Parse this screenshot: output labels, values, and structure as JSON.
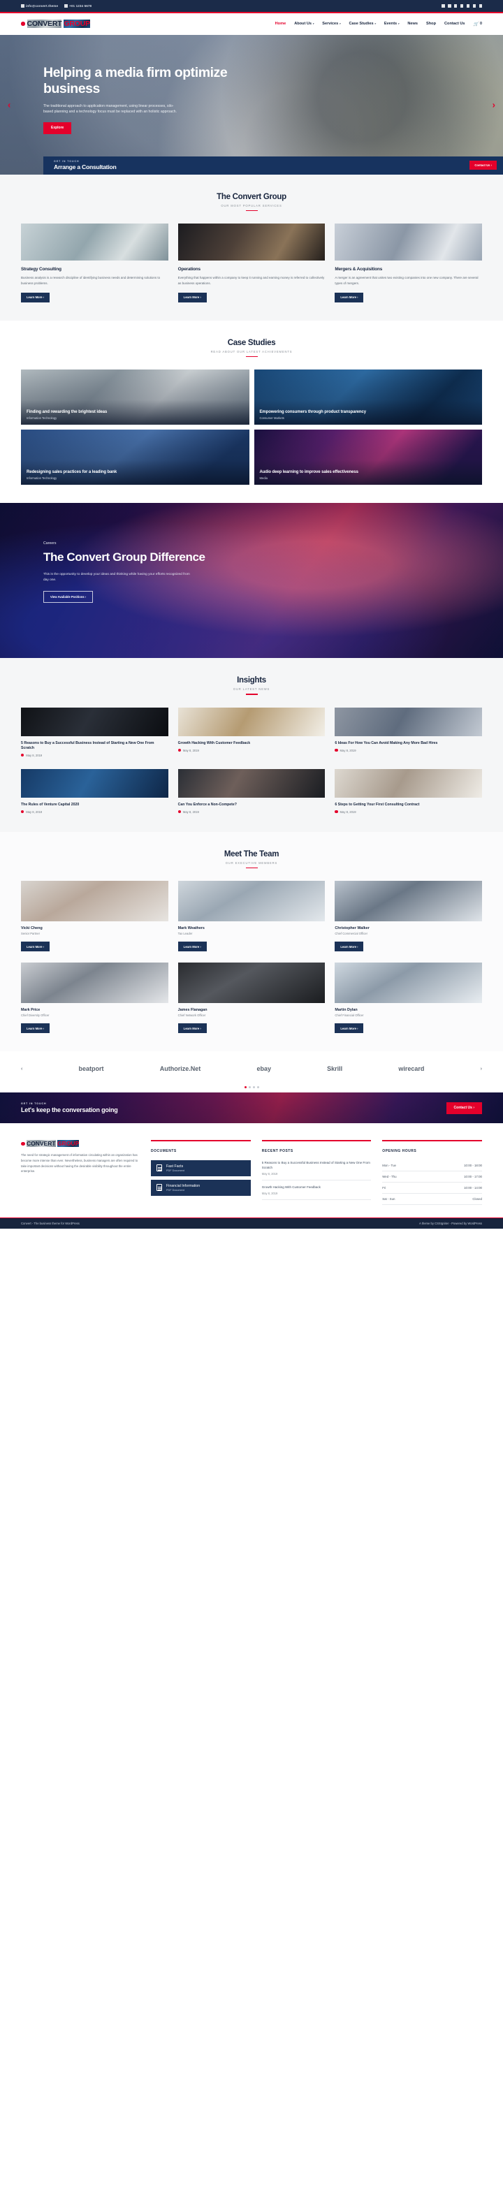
{
  "topbar": {
    "email": "info@convert.theme",
    "phone": "+01 1234 5678",
    "socials": [
      "facebook-icon",
      "twitter-icon",
      "youtube-icon",
      "flickr-icon",
      "linkedin-icon",
      "instagram-icon",
      "rss-icon"
    ]
  },
  "brand": {
    "part1": "CONVERT",
    "part2": "GROUP"
  },
  "nav": {
    "items": [
      {
        "label": "Home",
        "active": true,
        "caret": false
      },
      {
        "label": "About Us",
        "active": false,
        "caret": true
      },
      {
        "label": "Services",
        "active": false,
        "caret": true
      },
      {
        "label": "Case Studies",
        "active": false,
        "caret": true
      },
      {
        "label": "Events",
        "active": false,
        "caret": true
      },
      {
        "label": "News",
        "active": false,
        "caret": false
      },
      {
        "label": "Shop",
        "active": false,
        "caret": false
      },
      {
        "label": "Contact Us",
        "active": false,
        "caret": false
      }
    ],
    "cart_count": "0"
  },
  "hero": {
    "title": "Helping a media firm optimize business",
    "paragraph": "The traditional approach to application management, using linear processes, silo-based planning and a technology focus must be replaced with an holistic approach.",
    "cta": "Explore",
    "prev": "‹",
    "next": "›"
  },
  "consult": {
    "kicker": "GET IN TOUCH",
    "title": "Arrange a Consultation",
    "button": "Contact Us ›"
  },
  "services": {
    "heading": "The Convert Group",
    "subheading": "OUR MOST POPULAR SERVICES",
    "cards": [
      {
        "title": "Strategy Consulting",
        "text": "Business analysis is a research discipline of identifying business needs and determining solutions to business problems.",
        "button": "Learn More ›"
      },
      {
        "title": "Operations",
        "text": "Everything that happens within a company to keep it running and earning money is referred to collectively as business operations.",
        "button": "Learn More ›"
      },
      {
        "title": "Mergers & Acquisitions",
        "text": "A merger is an agreement that unites two existing companies into one new company. There are several types of mergers.",
        "button": "Learn More ›"
      }
    ]
  },
  "case_studies": {
    "heading": "Case Studies",
    "subheading": "READ ABOUT OUR LATEST ACHIEVEMENTS",
    "items": [
      {
        "title": "Finding and rewarding the brightest ideas",
        "category": "Information Technology"
      },
      {
        "title": "Empowering consumers through product transparency",
        "category": "Consumer Markets"
      },
      {
        "title": "Redesigning sales practices for a leading bank",
        "category": "Information Technology"
      },
      {
        "title": "Audio deep learning to improve sales effectiveness",
        "category": "Media"
      }
    ]
  },
  "difference": {
    "kicker": "Careers",
    "title": "The Convert Group Difference",
    "paragraph": "This is the opportunity to develop your ideas and thinking while having your efforts recognized from day one.",
    "button": "View Available Positions ›"
  },
  "insights": {
    "heading": "Insights",
    "subheading": "OUR LATEST NEWS",
    "posts": [
      {
        "title": "5 Reasons to Buy a Successful Business Instead of Starting a New One From Scratch",
        "date": "May 8, 2019"
      },
      {
        "title": "Growth Hacking With Customer Feedback",
        "date": "May 8, 2019"
      },
      {
        "title": "6 Ideas For How You Can Avoid Making Any More Bad Hires",
        "date": "May 8, 2019"
      },
      {
        "title": "The Rules of Venture Capital 2020",
        "date": "May 8, 2019"
      },
      {
        "title": "Can You Enforce a Non-Compete?",
        "date": "May 8, 2019"
      },
      {
        "title": "6 Steps to Getting Your First Consulting Contract",
        "date": "May 8, 2019"
      }
    ]
  },
  "team": {
    "heading": "Meet The Team",
    "subheading": "OUR EXECUTIVE MEMBERS",
    "members": [
      {
        "name": "Vicki Cheng",
        "role": "Senior Partner",
        "button": "Learn More ›"
      },
      {
        "name": "Mark Weathers",
        "role": "Tax Leader",
        "button": "Learn More ›"
      },
      {
        "name": "Christopher Walker",
        "role": "Chief Commercial Officer",
        "button": "Learn More ›"
      },
      {
        "name": "Mark Price",
        "role": "Chief Diversity Officer",
        "button": "Learn More ›"
      },
      {
        "name": "James Flanagan",
        "role": "Chief Network Officer",
        "button": "Learn More ›"
      },
      {
        "name": "Martin Dylan",
        "role": "Chief Financial Officer",
        "button": "Learn More ›"
      }
    ]
  },
  "partners": {
    "prev": "‹",
    "next": "›",
    "logos": [
      "beatport",
      "Authorize.Net",
      "ebay",
      "Skrill",
      "wirecard"
    ]
  },
  "cta_strip": {
    "kicker": "GET IN TOUCH",
    "title": "Let's keep the conversation going",
    "button": "Contact Us ›"
  },
  "footer": {
    "about": "The need for strategic management of information circulating within an organization has become more intense than ever. Nevertheless, business managers are often required to take important decisions without having the desirable visibility throughout the entire enterprise.",
    "documents_heading": "DOCUMENTS",
    "documents": [
      {
        "title": "Fast Facts",
        "sub": "PDF Document"
      },
      {
        "title": "Financial Information",
        "sub": "PDF Document"
      }
    ],
    "recent_heading": "RECENT POSTS",
    "recent": [
      {
        "title": "5 Reasons to Buy a Successful Business Instead of Starting a New One From Scratch",
        "date": "May 8, 2019"
      },
      {
        "title": "Growth Hacking With Customer Feedback",
        "date": "May 8, 2019"
      }
    ],
    "hours_heading": "OPENING HOURS",
    "hours": [
      {
        "day": "Mon - Tue",
        "time": "10:00 - 18:00"
      },
      {
        "day": "Wed - Thu",
        "time": "10:00 - 17:00"
      },
      {
        "day": "Fri",
        "time": "10:00 - 14:00"
      },
      {
        "day": "Sat - Sun",
        "time": "Closed"
      }
    ],
    "copyright_left": "Convert - The business theme for WordPress",
    "copyright_right": "A theme by CSSIgniter - Powered by WordPress"
  },
  "colors": {
    "accent": "#e4002b",
    "navy": "#17243d",
    "navy_mid": "#1b3257"
  }
}
